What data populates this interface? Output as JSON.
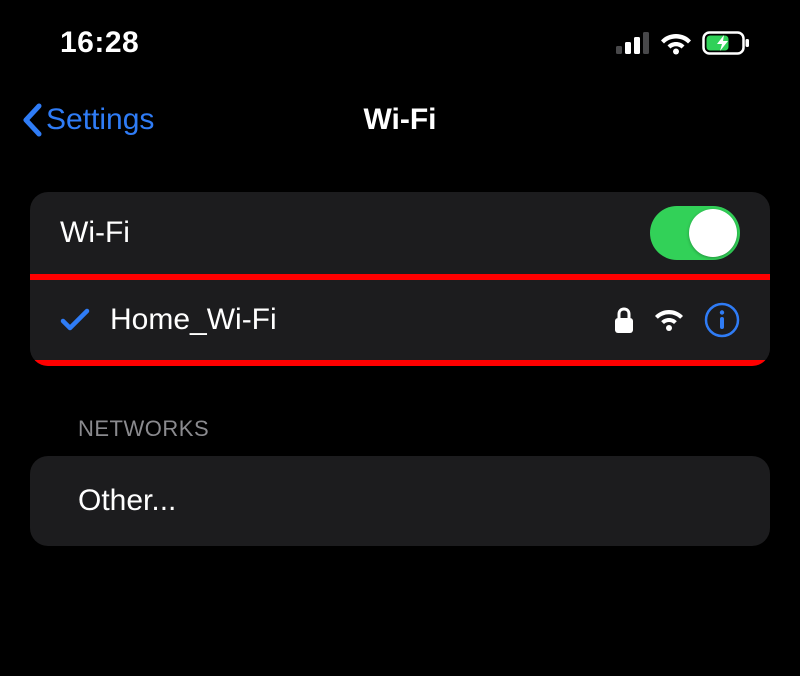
{
  "statusBar": {
    "time": "16:28"
  },
  "nav": {
    "back_label": "Settings",
    "title": "Wi-Fi"
  },
  "wifi": {
    "toggle_label": "Wi-Fi",
    "toggle_on": true,
    "connected_network": "Home_Wi-Fi"
  },
  "sections": {
    "networks_header": "Networks",
    "other_label": "Other..."
  },
  "colors": {
    "accent_blue": "#2f7cf6",
    "toggle_green": "#32d158",
    "highlight_red": "#ff0000"
  }
}
